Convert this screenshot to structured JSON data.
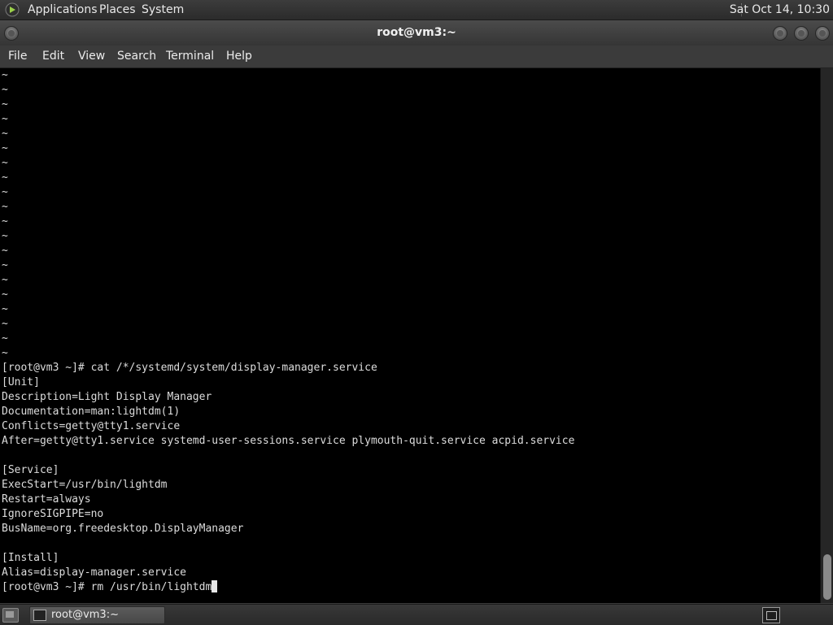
{
  "top_panel": {
    "menus": [
      "Applications",
      "Places",
      "System"
    ],
    "clock": "Sat Oct 14, 10:30",
    "logo_icon": "gnome-foot-icon"
  },
  "window": {
    "title": "root@vm3:~",
    "menubar": [
      "File",
      "Edit",
      "View",
      "Search",
      "Terminal",
      "Help"
    ]
  },
  "terminal": {
    "lines": [
      "~",
      "~",
      "~",
      "~",
      "~",
      "~",
      "~",
      "~",
      "~",
      "~",
      "~",
      "~",
      "~",
      "~",
      "~",
      "~",
      "~",
      "~",
      "~",
      "~",
      "[root@vm3 ~]# cat /*/systemd/system/display-manager.service",
      "[Unit]",
      "Description=Light Display Manager",
      "Documentation=man:lightdm(1)",
      "Conflicts=getty@tty1.service",
      "After=getty@tty1.service systemd-user-sessions.service plymouth-quit.service acpid.service",
      "",
      "[Service]",
      "ExecStart=/usr/bin/lightdm",
      "Restart=always",
      "IgnoreSIGPIPE=no",
      "BusName=org.freedesktop.DisplayManager",
      "",
      "[Install]",
      "Alias=display-manager.service"
    ],
    "prompt_line": "[root@vm3 ~]# rm /usr/bin/lightdm"
  },
  "taskbar": {
    "item_label": "root@vm3:~"
  }
}
